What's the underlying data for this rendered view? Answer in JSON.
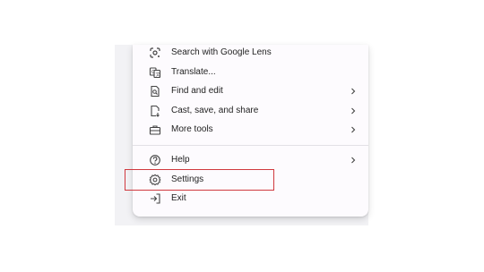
{
  "menu": {
    "items": [
      {
        "label": "Search with Google Lens",
        "icon": "google-lens-icon",
        "has_submenu": false
      },
      {
        "label": "Translate...",
        "icon": "translate-icon",
        "has_submenu": false
      },
      {
        "label": "Find and edit",
        "icon": "find-and-edit-icon",
        "has_submenu": true
      },
      {
        "label": "Cast, save, and share",
        "icon": "cast-save-share-icon",
        "has_submenu": true
      },
      {
        "label": "More tools",
        "icon": "more-tools-icon",
        "has_submenu": true
      }
    ],
    "bottom_items": [
      {
        "label": "Help",
        "icon": "help-icon",
        "has_submenu": true
      },
      {
        "label": "Settings",
        "icon": "gear-icon",
        "has_submenu": false,
        "highlighted": true
      },
      {
        "label": "Exit",
        "icon": "exit-icon",
        "has_submenu": false
      }
    ]
  },
  "colors": {
    "menu_background": "#fdfbfe",
    "text": "#1f1f1f",
    "highlight_border": "#d0393f"
  }
}
